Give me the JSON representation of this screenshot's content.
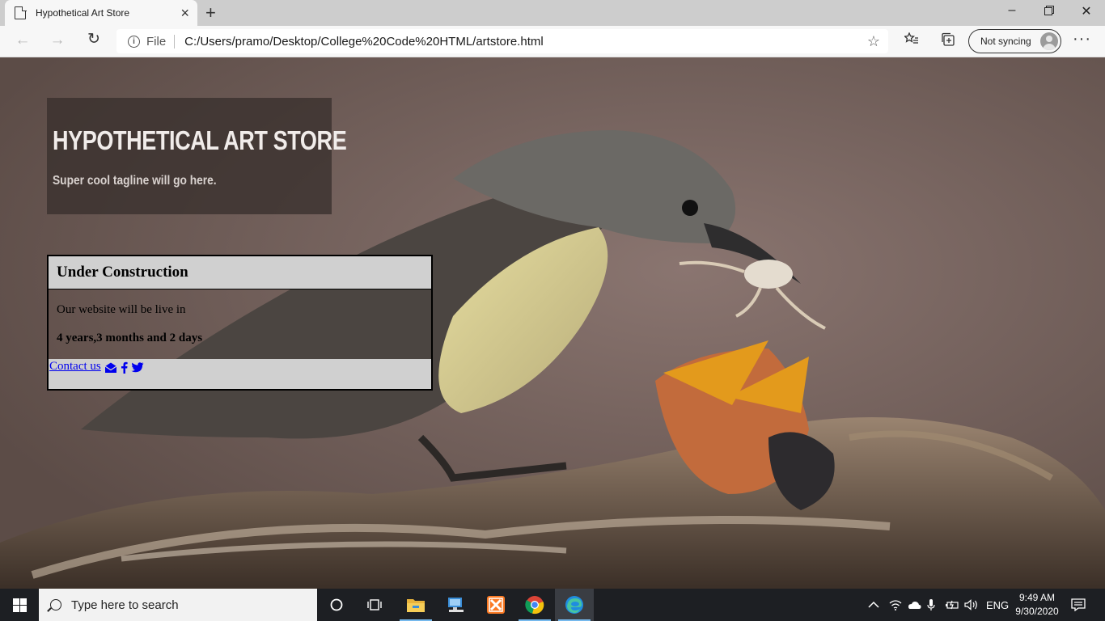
{
  "browser": {
    "tab_title": "Hypothetical Art Store",
    "scheme_label": "File",
    "url": "C:/Users/pramo/Desktop/College%20Code%20HTML/artstore.html",
    "sync_label": "Not syncing"
  },
  "page": {
    "site_title": "HYPOTHETICAL ART STORE",
    "tagline": "Super cool tagline will go here.",
    "panel_heading": "Under Construction",
    "panel_intro": "Our website will be live in",
    "countdown": "4 years,3 months and 2 days",
    "contact_link": "Contact us"
  },
  "taskbar": {
    "search_placeholder": "Type here to search",
    "language": "ENG",
    "time": "9:49 AM",
    "date": "9/30/2020"
  },
  "icons": {
    "social": [
      "envelope-icon",
      "facebook-icon",
      "twitter-icon"
    ],
    "taskbar_apps": [
      "cortana-icon",
      "task-view-icon",
      "file-explorer-icon",
      "network-drive-icon",
      "xampp-icon",
      "chrome-icon",
      "edge-icon"
    ]
  },
  "colors": {
    "link": "#0000ee",
    "panel_bg": "#d0d0d0",
    "hero_bg": "#38302d",
    "taskbar": "#1d1f23"
  }
}
